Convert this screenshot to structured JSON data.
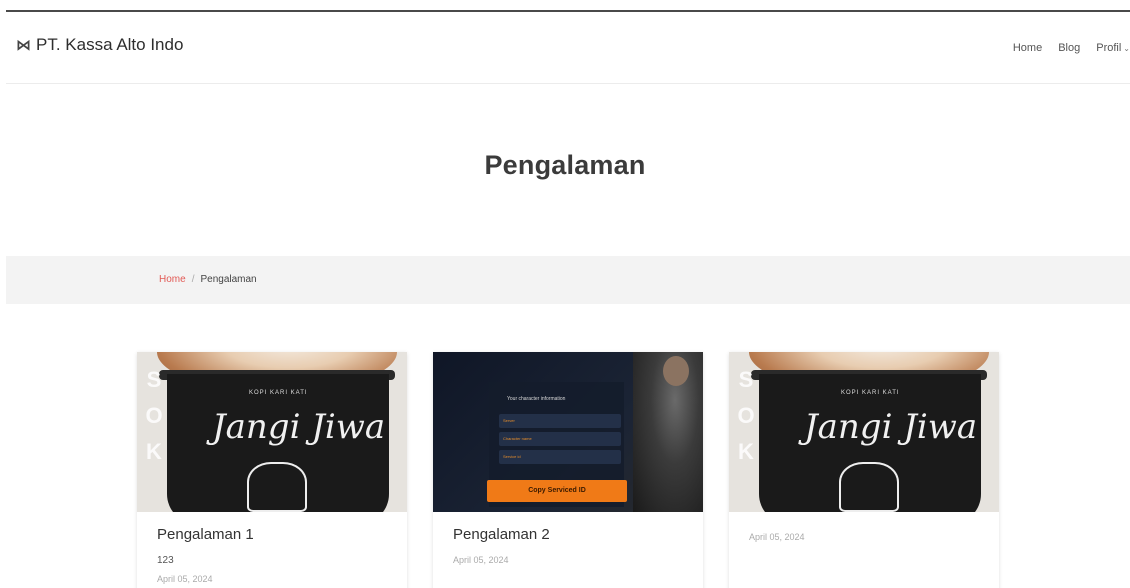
{
  "brand": {
    "icon": "kassa-logo-icon",
    "name": "PT. Kassa Alto Indo"
  },
  "nav": [
    {
      "label": "Home",
      "name": "nav-home"
    },
    {
      "label": "Blog",
      "name": "nav-blog"
    },
    {
      "label": "Profil",
      "name": "nav-profil",
      "dropdown": true
    }
  ],
  "page": {
    "title": "Pengalaman"
  },
  "breadcrumb": {
    "home": "Home",
    "separator": "/",
    "current": "Pengalaman"
  },
  "cards": [
    {
      "title": "Pengalaman 1",
      "text": "123",
      "date": "April 05, 2024",
      "image": "coffee-cup-image"
    },
    {
      "title": "Pengalaman 2",
      "text": "",
      "date": "April 05, 2024",
      "image": "game-screenshot-image",
      "image_text": {
        "heading": "Your character information",
        "fields": [
          "Server",
          "Character name",
          "Service id"
        ],
        "button": "Copy Serviced ID"
      }
    },
    {
      "title": "",
      "text": "",
      "date": "April 05, 2024",
      "image": "coffee-cup-image"
    }
  ],
  "cup": {
    "letters": [
      "S",
      "O",
      "K"
    ],
    "caption": "KOPI KARI KATI",
    "script": "Jangi Jiwa"
  },
  "colors": {
    "accent": "#e25a55",
    "orange": "#f07a17",
    "breadcrumb_bg": "#f3f3f3"
  }
}
